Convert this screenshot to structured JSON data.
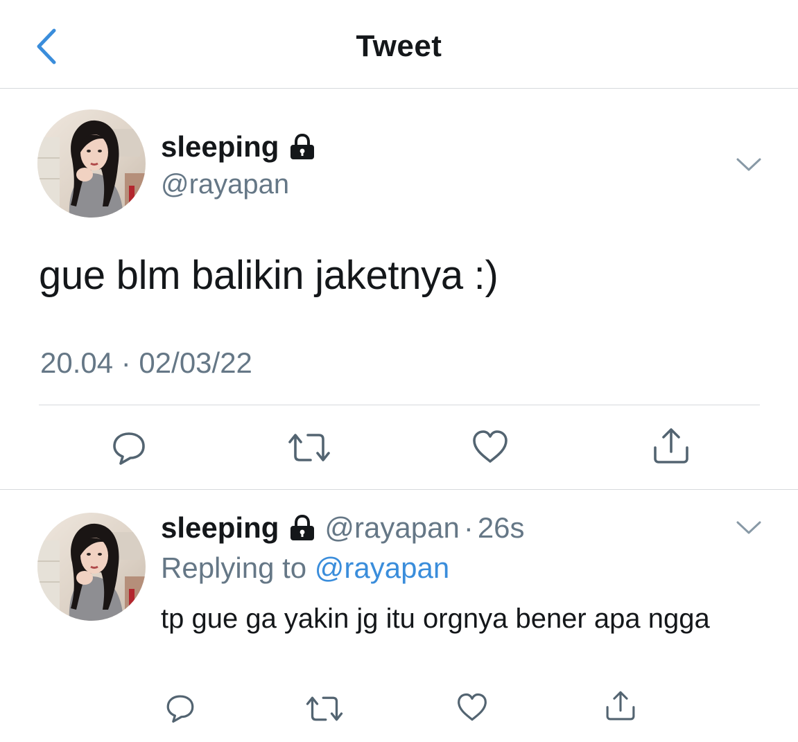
{
  "header": {
    "title": "Tweet",
    "back_icon": "chevron-left-icon"
  },
  "colors": {
    "accent": "#3a8ddb",
    "muted": "#657786",
    "text": "#14171a",
    "divider": "#d6d9dc"
  },
  "main_tweet": {
    "display_name": "sleeping",
    "handle": "@rayapan",
    "protected_icon": "lock-icon",
    "text": "gue blm balikin jaketnya :)",
    "timestamp": "20.04 · 02/03/22",
    "actions": [
      "reply-icon",
      "retweet-icon",
      "like-icon",
      "share-icon"
    ]
  },
  "reply_tweet": {
    "display_name": "sleeping",
    "handle": "@rayapan",
    "separator": "·",
    "age": "26s",
    "replying_prefix": "Replying to",
    "replying_to": "@rayapan",
    "text": "tp gue ga yakin jg itu orgnya bener apa ngga",
    "actions": [
      "reply-icon",
      "retweet-icon",
      "like-icon",
      "share-icon"
    ]
  }
}
